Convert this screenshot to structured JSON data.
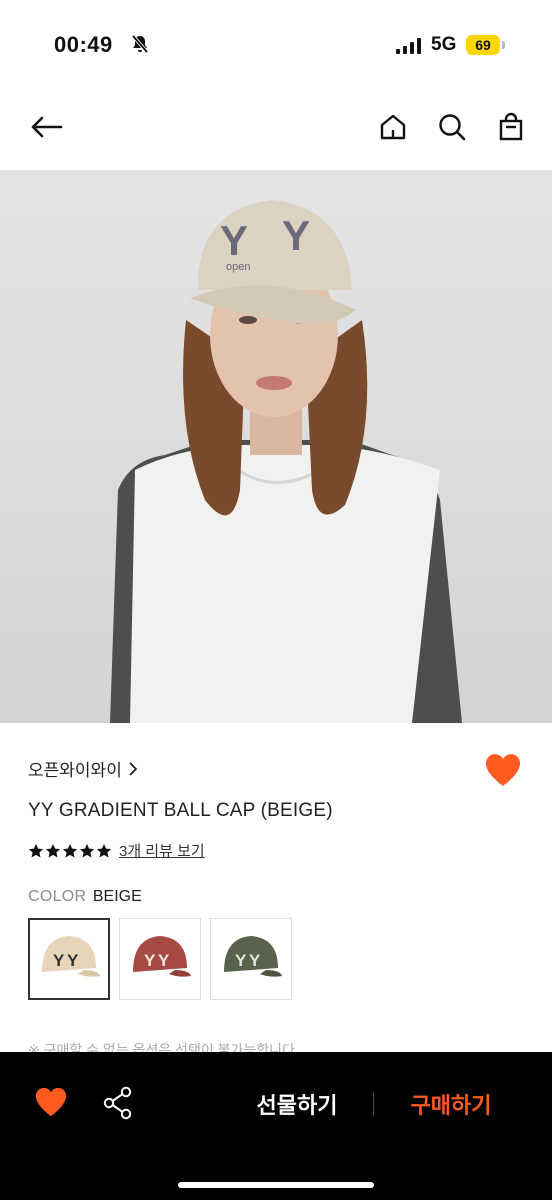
{
  "status_bar": {
    "time": "00:49",
    "network": "5G",
    "battery": "69"
  },
  "brand": {
    "name": "오픈와이와이",
    "chevron": "›"
  },
  "product": {
    "title": "YY GRADIENT BALL CAP (BEIGE)",
    "rating": 5,
    "review_link": "3개 리뷰 보기",
    "color_label": "COLOR",
    "color_value": "BEIGE",
    "notice": "※ 구매할 수 없는 옵션은 선택이 불가능합니다"
  },
  "swatches": [
    {
      "name": "BEIGE",
      "color": "#e6d5b8",
      "selected": true
    },
    {
      "name": "RED",
      "color": "#a84a44",
      "selected": false
    },
    {
      "name": "KHAKI",
      "color": "#59624d",
      "selected": false
    }
  ],
  "bottom_bar": {
    "gift_label": "선물하기",
    "buy_label": "구매하기"
  },
  "colors": {
    "accent": "#ff5a1f",
    "bar_bg": "#000000",
    "heart": "#ff5a1f"
  },
  "icons": [
    "bell-slash-icon",
    "back-arrow-icon",
    "home-icon",
    "search-icon",
    "shopping-bag-icon",
    "heart-icon",
    "share-icon",
    "star-icon",
    "chevron-right-icon"
  ]
}
